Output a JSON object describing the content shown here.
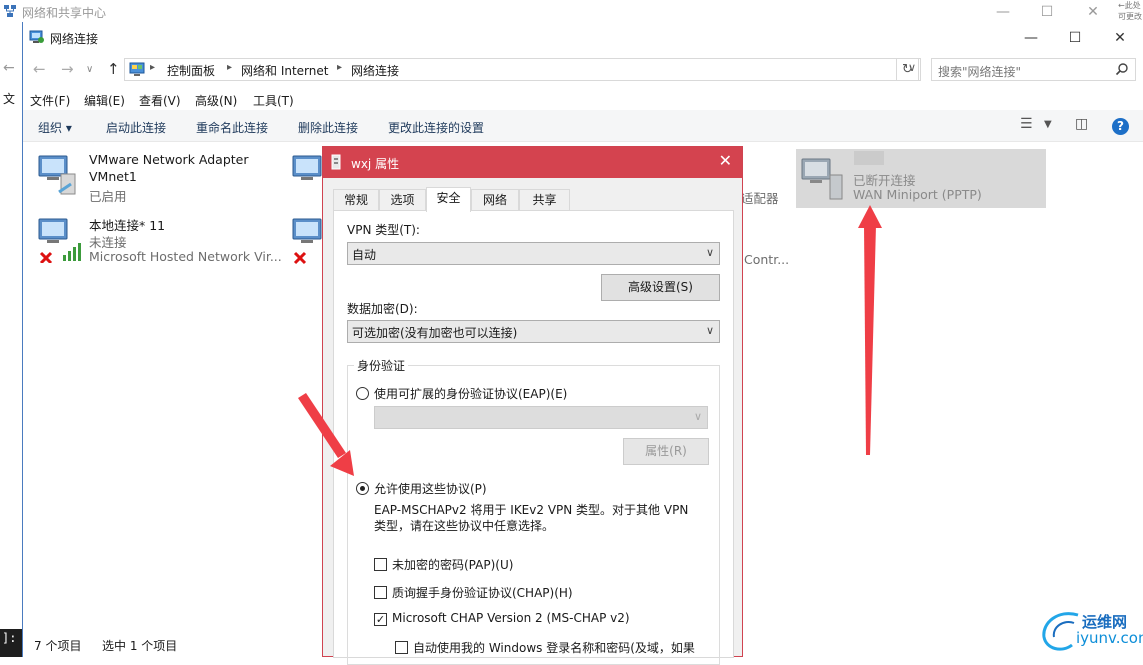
{
  "background_window": {
    "title": "网络和共享中心",
    "file_menu_fragment": "文",
    "corner_text": "←此处可更改",
    "terminal_fragment": "]:"
  },
  "window": {
    "title": "网络连接",
    "address": {
      "crumbs": [
        "控制面板",
        "网络和 Internet",
        "网络连接"
      ],
      "search_placeholder": "搜索\"网络连接\""
    },
    "menu": [
      "文件(F)",
      "编辑(E)",
      "查看(V)",
      "高级(N)",
      "工具(T)"
    ],
    "commands": {
      "organize": "组织 ▾",
      "items": [
        "启动此连接",
        "重命名此连接",
        "删除此连接",
        "更改此连接的设置"
      ]
    },
    "connections": [
      {
        "name": "VMware Network Adapter",
        "line2": "VMnet1",
        "line3": "已启用"
      },
      {
        "name": "本地连接* 11",
        "line2": "未连接",
        "line3": "Microsoft Hosted Network Vir..."
      },
      {
        "partial_text": "适配器"
      },
      {
        "partial_text": "Contr..."
      },
      {
        "name": "",
        "line2": "已断开连接",
        "line3": "WAN Miniport (PPTP)"
      }
    ],
    "status": {
      "count": "7 个项目",
      "selected": "选中 1 个项目"
    }
  },
  "dialog": {
    "title": "wxj 属性",
    "tabs": [
      "常规",
      "选项",
      "安全",
      "网络",
      "共享"
    ],
    "active_tab": "安全",
    "vpn_type_label": "VPN 类型(T):",
    "vpn_type_value": "自动",
    "advanced_button": "高级设置(S)",
    "encryption_label": "数据加密(D):",
    "encryption_value": "可选加密(没有加密也可以连接)",
    "auth_group": "身份验证",
    "eap_radio": "使用可扩展的身份验证协议(EAP)(E)",
    "eap_combo_value": "",
    "properties_button": "属性(R)",
    "allow_radio": "允许使用这些协议(P)",
    "note_line1": "EAP-MSCHAPv2 将用于 IKEv2 VPN 类型。对于其他 VPN",
    "note_line2": "类型，请在这些协议中任意选择。",
    "checkboxes": [
      {
        "label": "未加密的密码(PAP)(U)",
        "checked": false
      },
      {
        "label": "质询握手身份验证协议(CHAP)(H)",
        "checked": false
      },
      {
        "label": "Microsoft CHAP Version 2 (MS-CHAP v2)",
        "checked": true
      },
      {
        "label": "自动使用我的 Windows 登录名称和密码(及域，如果",
        "checked": false
      }
    ]
  },
  "watermark": {
    "cn": "运维网",
    "en": "iyunv.com"
  },
  "colors": {
    "dialog_title": "#d4434f",
    "arrow": "#ef3e46",
    "help": "#1d6fc7"
  }
}
